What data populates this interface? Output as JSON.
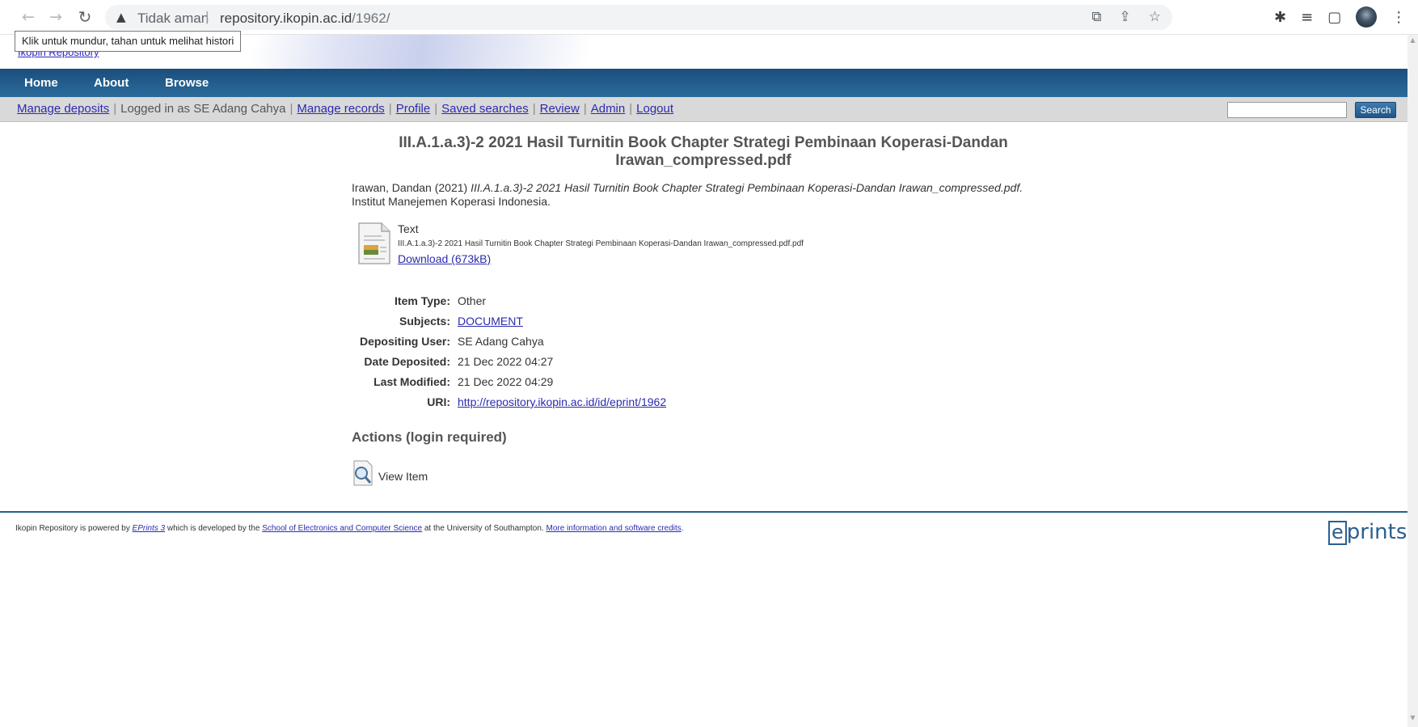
{
  "browser": {
    "security_label": "Tidak aman",
    "url_domain": "repository.ikopin.ac.id",
    "url_path": "/1962/",
    "tooltip": "Klik untuk mundur, tahan untuk melihat histori"
  },
  "header": {
    "logo_alt": "Ikopin Repository"
  },
  "menu": {
    "home": "Home",
    "about": "About",
    "browse": "Browse"
  },
  "userbar": {
    "manage_deposits": "Manage deposits",
    "logged_in": "Logged in as SE Adang Cahya",
    "manage_records": "Manage records",
    "profile": "Profile",
    "saved_searches": "Saved searches",
    "review": "Review",
    "admin": "Admin",
    "logout": "Logout",
    "search_button": "Search",
    "search_value": ""
  },
  "record": {
    "title": "III.A.1.a.3)-2 2021 Hasil Turnitin Book Chapter Strategi Pembinaan Koperasi-Dandan Irawan_compressed.pdf",
    "citation_author": "Irawan, Dandan (2021) ",
    "citation_title": "III.A.1.a.3)-2 2021 Hasil Turnitin Book Chapter Strategi Pembinaan Koperasi-Dandan Irawan_compressed.pdf.",
    "citation_publisher": "Institut Manejemen Koperasi Indonesia.",
    "doc_type": "Text",
    "doc_filename": "III.A.1.a.3)-2 2021 Hasil Turnitin Book Chapter Strategi Pembinaan Koperasi-Dandan Irawan_compressed.pdf.pdf",
    "download": "Download (673kB)"
  },
  "meta": {
    "item_type_label": "Item Type:",
    "item_type": "Other",
    "subjects_label": "Subjects:",
    "subjects": "DOCUMENT",
    "depositing_user_label": "Depositing User:",
    "depositing_user": "SE Adang Cahya",
    "date_deposited_label": "Date Deposited:",
    "date_deposited": "21 Dec 2022 04:27",
    "last_modified_label": "Last Modified:",
    "last_modified": "21 Dec 2022 04:29",
    "uri_label": "URI:",
    "uri": "http://repository.ikopin.ac.id/id/eprint/1962"
  },
  "actions": {
    "heading": "Actions (login required)",
    "view_item": "View Item"
  },
  "footer": {
    "part1": "Ikopin Repository is powered by ",
    "eprints_link": "EPrints 3",
    "part2": " which is developed by the ",
    "school_link": "School of Electronics and Computer Science",
    "part3": " at the University of Southampton. ",
    "more_link": "More information and software credits",
    "part4": ".",
    "logo_e": "e",
    "logo_rest": "prints"
  },
  "colors": {
    "menubar": "#24608f",
    "link": "#2b2bb0",
    "userbar": "#d9d9d9"
  }
}
